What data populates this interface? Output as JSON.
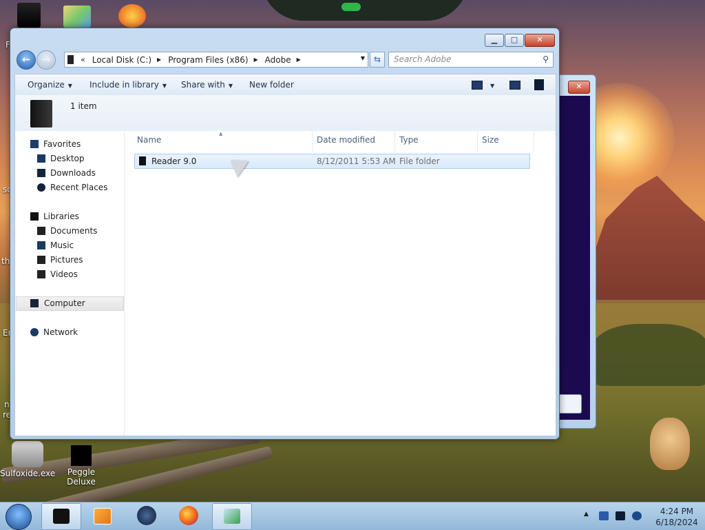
{
  "desktop": {
    "icons": [
      {
        "label": "Sulfoxide.exe"
      },
      {
        "label": "Peggle Deluxe"
      }
    ],
    "edge_fragments": [
      "F",
      "sc",
      "th",
      "Er",
      "n",
      "re"
    ]
  },
  "explorer": {
    "address": {
      "overflow": "«",
      "crumbs": [
        "Local Disk (C:)",
        "Program Files (x86)",
        "Adobe"
      ]
    },
    "search_placeholder": "Search Adobe",
    "toolbar": {
      "organize": "Organize",
      "include_in_library": "Include in library",
      "share_with": "Share with",
      "new_folder": "New folder"
    },
    "info": {
      "count": "1 item"
    },
    "nav": {
      "favorites": "Favorites",
      "desktop": "Desktop",
      "downloads": "Downloads",
      "recent_places": "Recent Places",
      "libraries": "Libraries",
      "documents": "Documents",
      "music": "Music",
      "pictures": "Pictures",
      "videos": "Videos",
      "computer": "Computer",
      "network": "Network"
    },
    "columns": {
      "name": "Name",
      "date_modified": "Date modified",
      "type": "Type",
      "size": "Size"
    },
    "files": [
      {
        "name": "Reader 9.0",
        "date_modified": "8/12/2011 5:53 AM",
        "type": "File folder",
        "size": ""
      }
    ]
  },
  "taskbar": {
    "time": "4:24 PM",
    "date": "6/18/2024"
  },
  "colors": {
    "window_frame": "#b4cde6",
    "selection": "#d9eafb",
    "taskbar": "#93b8d8",
    "close_red": "#c74128"
  }
}
